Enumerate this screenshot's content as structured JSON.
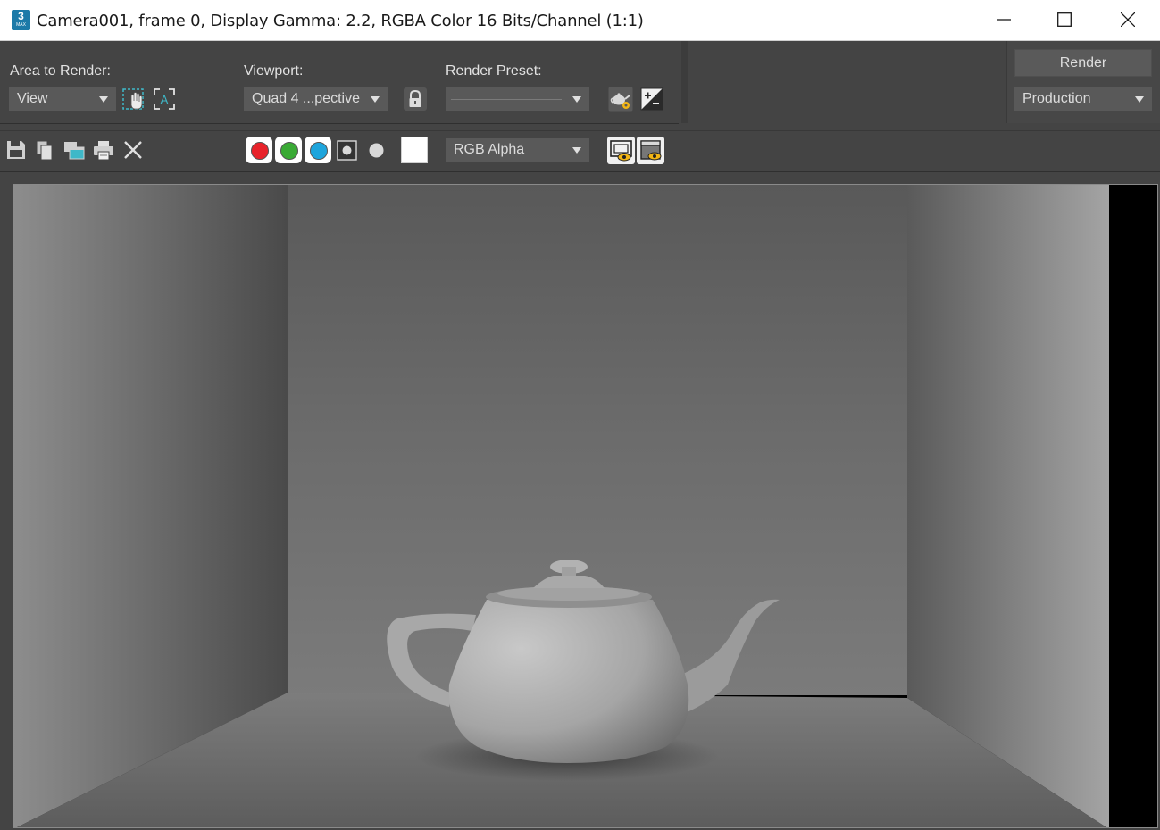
{
  "window": {
    "title": "Camera001, frame 0, Display Gamma: 2.2, RGBA Color 16 Bits/Channel (1:1)",
    "app_icon_text": "3",
    "app_icon_subtext": "MAX",
    "controls": [
      "minimize-icon",
      "maximize-icon",
      "close-icon"
    ]
  },
  "render_settings": {
    "area_to_render_label": "Area to Render:",
    "area_to_render_value": "View",
    "viewport_label": "Viewport:",
    "viewport_value": "Quad 4 ...pective",
    "render_preset_label": "Render Preset:",
    "render_preset_value": "",
    "render_button": "Render",
    "render_mode_value": "Production"
  },
  "toolbar": {
    "channel_display_value": "RGB Alpha",
    "channels": [
      {
        "name": "red",
        "color": "#e8232b",
        "enabled": true
      },
      {
        "name": "green",
        "color": "#3aaa35",
        "enabled": true
      },
      {
        "name": "blue",
        "color": "#1ea5dc",
        "enabled": true
      }
    ],
    "background_swatch_color": "#ffffff"
  },
  "colors": {
    "panel_bg": "#444444",
    "dropdown_bg": "#595959",
    "titlebar_bg": "#ffffff"
  }
}
